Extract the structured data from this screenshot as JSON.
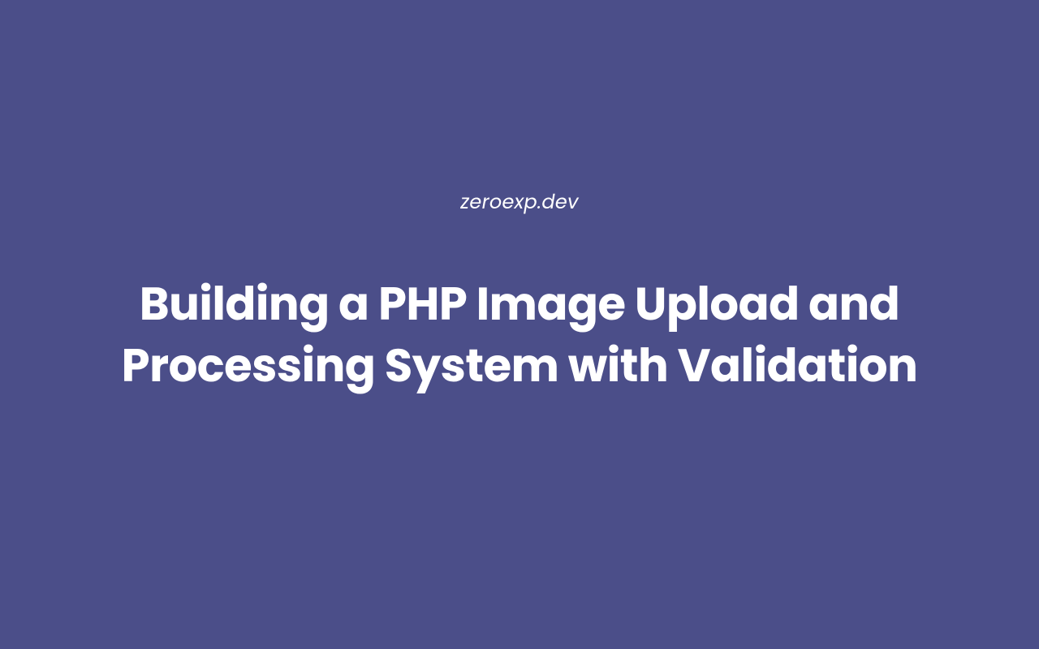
{
  "header": {
    "subtitle": "zeroexp.dev",
    "title": "Building a PHP Image Upload and Processing System with Validation"
  },
  "colors": {
    "background": "#4b4e89",
    "text": "#ffffff"
  }
}
